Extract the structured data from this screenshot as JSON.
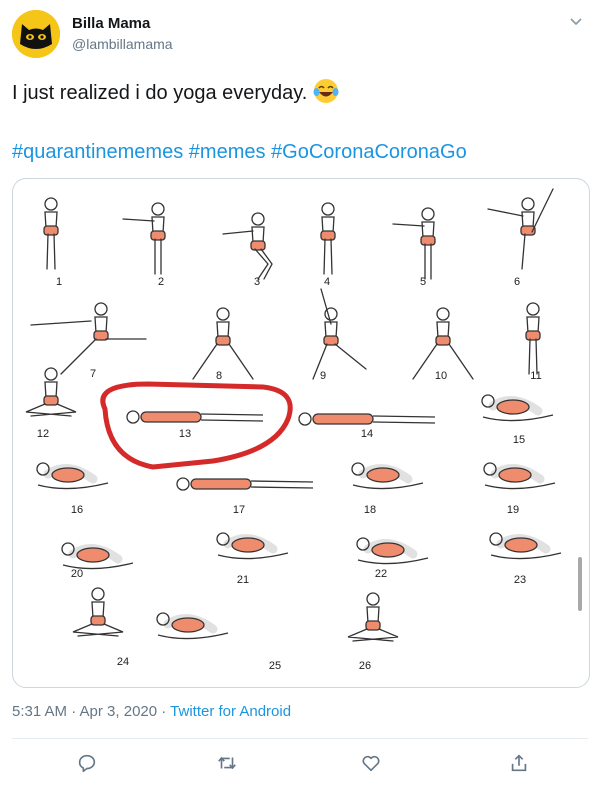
{
  "tweet": {
    "author_name": "Billa Mama",
    "author_handle": "@lambillamama",
    "text": "I just realized i do yoga everyday.",
    "emoji": "face-with-tears-of-joy",
    "hashtags": [
      "#quarantinememes",
      "#memes",
      "#GoCoronaCoronaGo"
    ],
    "timestamp": "5:31 AM · Apr 3, 2020 · ",
    "source": "Twitter for Android"
  },
  "image": {
    "pose_numbers": [
      "1",
      "2",
      "3",
      "4",
      "5",
      "6",
      "7",
      "8",
      "9",
      "10",
      "11",
      "12",
      "13",
      "14",
      "15",
      "16",
      "17",
      "18",
      "19",
      "20",
      "21",
      "22",
      "23",
      "24",
      "25",
      "26"
    ],
    "highlighted_pose": "13",
    "accent_color": "#f08c6e",
    "highlight_color": "#d42a2a"
  },
  "actions": [
    "reply-icon",
    "retweet-icon",
    "like-icon",
    "share-icon"
  ]
}
